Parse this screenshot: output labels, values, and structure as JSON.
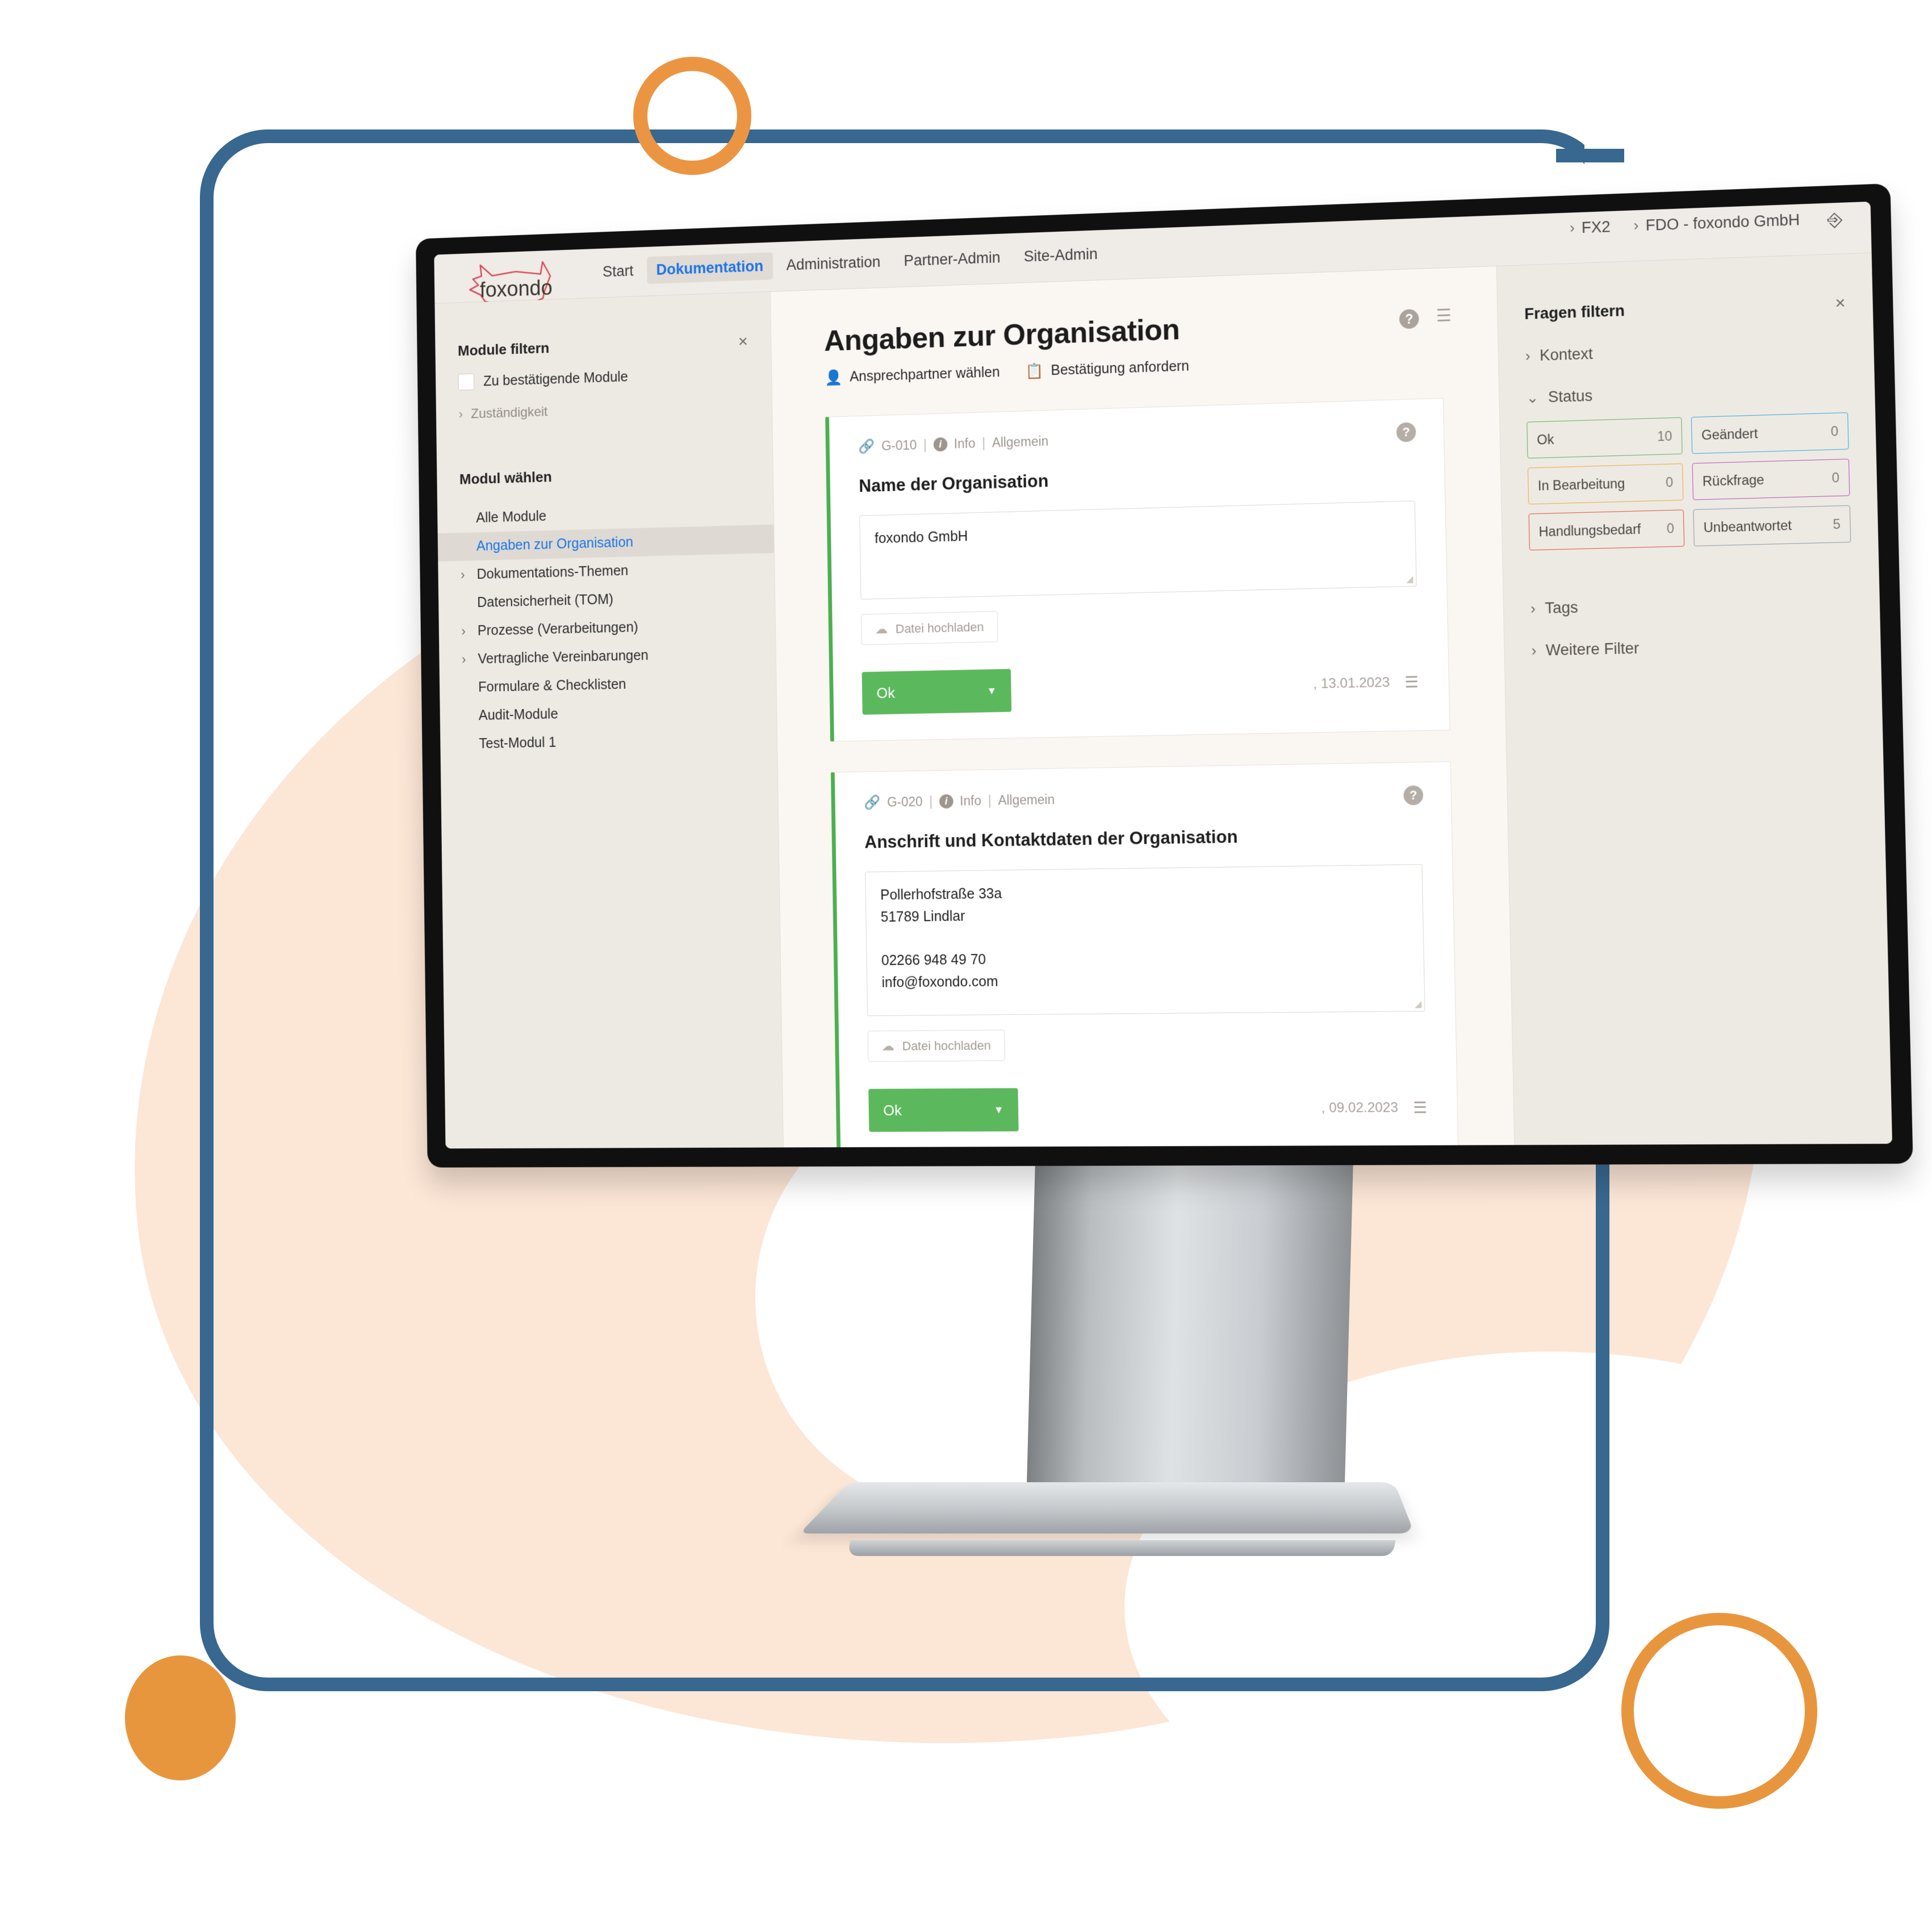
{
  "brand": {
    "name": "foxondo",
    "logo_color": "#d94a5a"
  },
  "topbar": {
    "nav": [
      {
        "label": "Start",
        "active": false
      },
      {
        "label": "Dokumentation",
        "active": true
      },
      {
        "label": "Administration",
        "active": false
      },
      {
        "label": "Partner-Admin",
        "active": false
      },
      {
        "label": "Site-Admin",
        "active": false
      }
    ],
    "breadcrumbs": [
      {
        "chevron": "›",
        "label": "FX2"
      },
      {
        "chevron": "›",
        "label": "FDO - foxondo GmbH"
      }
    ],
    "logout_icon": "logout-icon"
  },
  "sidebar": {
    "filter_title": "Module filtern",
    "close_icon": "×",
    "checkbox_label": "Zu bestätigende Module",
    "checkbox_checked": false,
    "responsibility": {
      "chevron": "›",
      "label": "Zuständigkeit"
    },
    "select_title": "Modul wählen",
    "modules": [
      {
        "label": "Alle Module",
        "expandable": false,
        "selected": false
      },
      {
        "label": "Angaben zur Organisation",
        "expandable": false,
        "selected": true
      },
      {
        "label": "Dokumentations-Themen",
        "expandable": true,
        "selected": false
      },
      {
        "label": "Datensicherheit (TOM)",
        "expandable": false,
        "selected": false
      },
      {
        "label": "Prozesse (Verarbeitungen)",
        "expandable": true,
        "selected": false
      },
      {
        "label": "Vertragliche Vereinbarungen",
        "expandable": true,
        "selected": false
      },
      {
        "label": "Formulare & Checklisten",
        "expandable": false,
        "selected": false
      },
      {
        "label": "Audit-Module",
        "expandable": false,
        "selected": false
      },
      {
        "label": "Test-Modul 1",
        "expandable": false,
        "selected": false
      }
    ]
  },
  "main": {
    "title": "Angaben zur Organisation",
    "actions": [
      {
        "icon": "person-icon",
        "glyph": "●",
        "label": "Ansprechpartner wählen"
      },
      {
        "icon": "clipboard-check-icon",
        "glyph": "▣",
        "label": "Bestätigung anfordern"
      }
    ],
    "header_icons": [
      {
        "name": "help-icon",
        "glyph": "?"
      },
      {
        "name": "notes-icon",
        "glyph": "☰"
      }
    ],
    "cards": [
      {
        "code": "G-010",
        "info_label": "Info",
        "category": "Allgemein",
        "question": "Name der Organisation",
        "answer": "foxondo GmbH",
        "upload_label": "Datei hochladen",
        "status_label": "Ok",
        "status_color": "#5cb85c",
        "date": ", 13.01.2023"
      },
      {
        "code": "G-020",
        "info_label": "Info",
        "category": "Allgemein",
        "question": "Anschrift und Kontaktdaten der Organisation",
        "answer": "Pollerhofstraße 33a\n51789 Lindlar\n\n02266 948 49 70\ninfo@foxondo.com",
        "upload_label": "Datei hochladen",
        "status_label": "Ok",
        "status_color": "#5cb85c",
        "date": ", 09.02.2023"
      }
    ]
  },
  "filters": {
    "title": "Fragen filtern",
    "close_icon": "×",
    "groups": [
      {
        "chevron": "›",
        "label": "Kontext",
        "expanded": false
      },
      {
        "chevron": "⌄",
        "label": "Status",
        "expanded": true
      }
    ],
    "status_chips": [
      {
        "label": "Ok",
        "count": "10",
        "color": "#61b15a"
      },
      {
        "label": "Geändert",
        "count": "0",
        "color": "#35a8dd"
      },
      {
        "label": "In Bearbeitung",
        "count": "0",
        "color": "#edab35"
      },
      {
        "label": "Rückfrage",
        "count": "0",
        "color": "#b451ba"
      },
      {
        "label": "Handlungsbedarf",
        "count": "0",
        "color": "#e0503c"
      },
      {
        "label": "Unbeantwortet",
        "count": "5",
        "color": "#8d9aa0"
      }
    ],
    "tail_groups": [
      {
        "chevron": "›",
        "label": "Tags"
      },
      {
        "chevron": "›",
        "label": "Weitere Filter"
      }
    ]
  },
  "decor": {
    "blue": "#386790",
    "orange": "#e8963e",
    "peach": "#fce6d6"
  }
}
